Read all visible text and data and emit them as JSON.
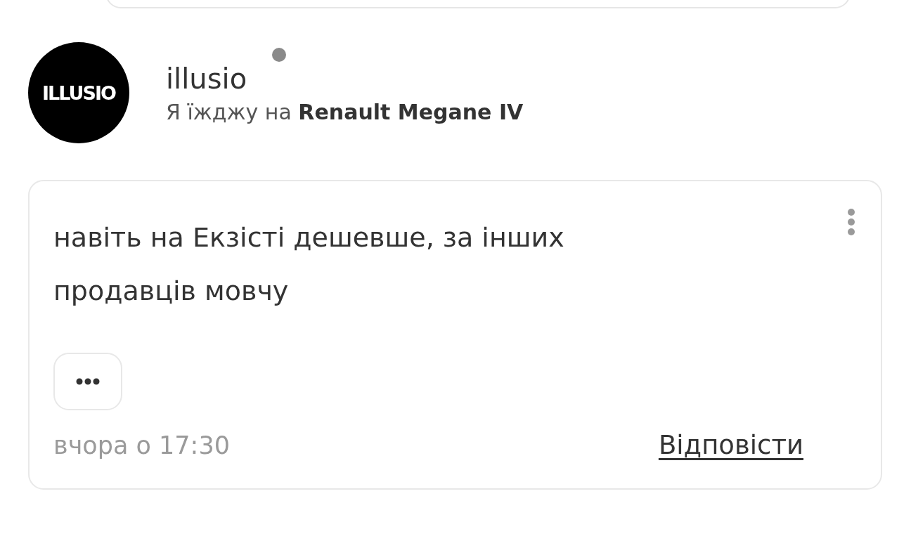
{
  "author": {
    "avatar_text": "ILLUSIO",
    "name": "illusio",
    "online": false,
    "subtitle": "Я їжджу на **Renault Megane IV**"
  },
  "comment": {
    "text": "навіть на Екзісті дешевше, за інших продавців мовчу",
    "time": "вчора о 17:30",
    "reply": "Відповісти"
  }
}
